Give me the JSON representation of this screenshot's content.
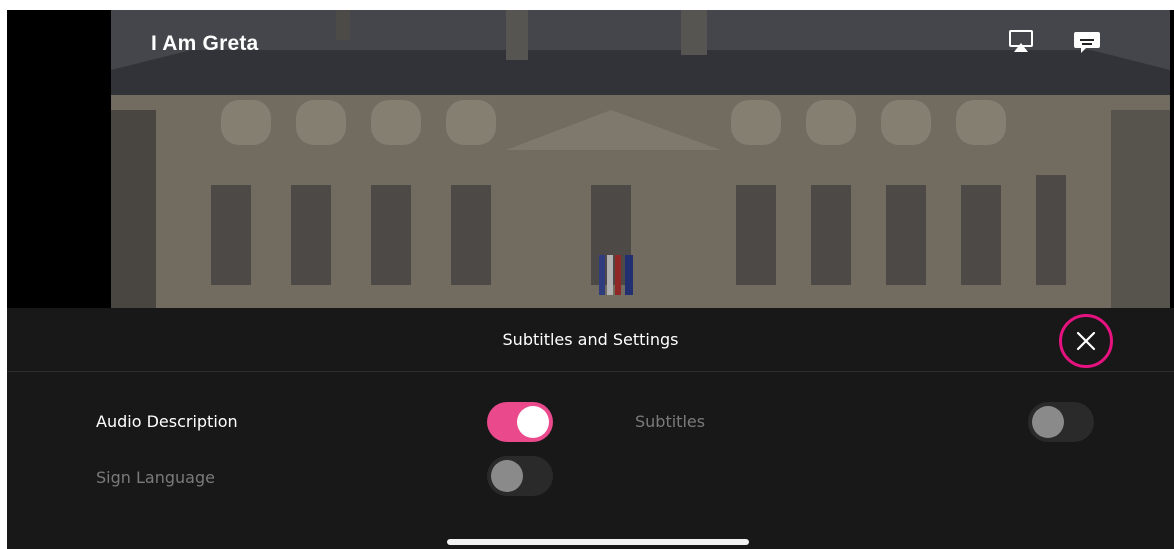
{
  "video": {
    "title": "I Am Greta"
  },
  "panel": {
    "title": "Subtitles and Settings"
  },
  "options": {
    "audio_description": {
      "label": "Audio Description",
      "enabled": true
    },
    "sign_language": {
      "label": "Sign Language",
      "enabled": false
    },
    "subtitles": {
      "label": "Subtitles",
      "enabled": false
    }
  },
  "icons": {
    "airplay": "airplay-icon",
    "subtitles": "subtitles-icon",
    "close": "close-icon"
  },
  "colors": {
    "accent": "#ea4a8c",
    "close_ring": "#e5127f",
    "panel_bg": "#181818"
  }
}
